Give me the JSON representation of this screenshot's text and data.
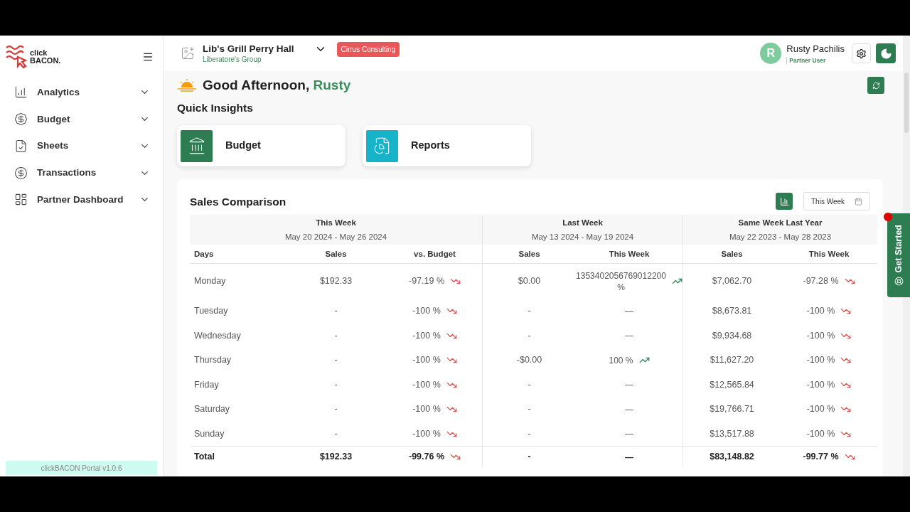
{
  "logo": {
    "line1": "click",
    "line2": "BACON."
  },
  "sidebar": {
    "items": [
      {
        "label": "Analytics"
      },
      {
        "label": "Budget"
      },
      {
        "label": "Sheets"
      },
      {
        "label": "Transactions"
      },
      {
        "label": "Partner Dashboard"
      }
    ],
    "version": "clickBACON Portal v1.0.6"
  },
  "header": {
    "location": "Lib's Grill Perry Hall",
    "group": "Liberatore's Group",
    "badge": "Cirrus Consulting",
    "user": {
      "initial": "R",
      "name": "Rusty Pachilis",
      "role": "Partner User"
    }
  },
  "greeting": {
    "text": "Good Afternoon,",
    "name": "Rusty"
  },
  "quick_insights": {
    "title": "Quick Insights",
    "cards": [
      {
        "label": "Budget",
        "color": "#2e7d52"
      },
      {
        "label": "Reports",
        "color": "#17b3c9"
      }
    ]
  },
  "sales_comparison": {
    "title": "Sales Comparison",
    "period": "This Week",
    "groups": [
      {
        "title": "This Week",
        "range": "May 20 2024 - May 26 2024"
      },
      {
        "title": "Last Week",
        "range": "May 13 2024 - May 19 2024"
      },
      {
        "title": "Same Week Last Year",
        "range": "May 22 2023 - May 28 2023"
      }
    ],
    "columns": [
      "Days",
      "Sales",
      "vs. Budget",
      "Sales",
      "This Week",
      "Sales",
      "This Week"
    ],
    "rows": [
      {
        "kind": "day",
        "cells": [
          {
            "kind": "plain",
            "text": "Monday"
          },
          {
            "kind": "plain",
            "text": "$192.33"
          },
          {
            "kind": "down",
            "text": "-97.19 %"
          },
          {
            "kind": "plain",
            "text": "$0.00"
          },
          {
            "kind": "up",
            "text": "1353402056769012200 %"
          },
          {
            "kind": "plain",
            "text": "$7,062.70"
          },
          {
            "kind": "down",
            "text": "-97.28 %"
          }
        ]
      },
      {
        "kind": "day",
        "cells": [
          {
            "kind": "plain",
            "text": "Tuesday"
          },
          {
            "kind": "plain",
            "text": "-"
          },
          {
            "kind": "down",
            "text": "-100 %"
          },
          {
            "kind": "plain",
            "text": "-"
          },
          {
            "kind": "plain",
            "text": "—"
          },
          {
            "kind": "plain",
            "text": "$8,673.81"
          },
          {
            "kind": "down",
            "text": "-100 %"
          }
        ]
      },
      {
        "kind": "day",
        "cells": [
          {
            "kind": "plain",
            "text": "Wednesday"
          },
          {
            "kind": "plain",
            "text": "-"
          },
          {
            "kind": "down",
            "text": "-100 %"
          },
          {
            "kind": "plain",
            "text": "-"
          },
          {
            "kind": "plain",
            "text": "—"
          },
          {
            "kind": "plain",
            "text": "$9,934.68"
          },
          {
            "kind": "down",
            "text": "-100 %"
          }
        ]
      },
      {
        "kind": "day",
        "cells": [
          {
            "kind": "plain",
            "text": "Thursday"
          },
          {
            "kind": "plain",
            "text": "-"
          },
          {
            "kind": "down",
            "text": "-100 %"
          },
          {
            "kind": "plain",
            "text": "-$0.00"
          },
          {
            "kind": "up",
            "text": "100 %"
          },
          {
            "kind": "plain",
            "text": "$11,627.20"
          },
          {
            "kind": "down",
            "text": "-100 %"
          }
        ]
      },
      {
        "kind": "day",
        "cells": [
          {
            "kind": "plain",
            "text": "Friday"
          },
          {
            "kind": "plain",
            "text": "-"
          },
          {
            "kind": "down",
            "text": "-100 %"
          },
          {
            "kind": "plain",
            "text": "-"
          },
          {
            "kind": "plain",
            "text": "—"
          },
          {
            "kind": "plain",
            "text": "$12,565.84"
          },
          {
            "kind": "down",
            "text": "-100 %"
          }
        ]
      },
      {
        "kind": "day",
        "cells": [
          {
            "kind": "plain",
            "text": "Saturday"
          },
          {
            "kind": "plain",
            "text": "-"
          },
          {
            "kind": "down",
            "text": "-100 %"
          },
          {
            "kind": "plain",
            "text": "-"
          },
          {
            "kind": "plain",
            "text": "—"
          },
          {
            "kind": "plain",
            "text": "$19,766.71"
          },
          {
            "kind": "down",
            "text": "-100 %"
          }
        ]
      },
      {
        "kind": "day",
        "cells": [
          {
            "kind": "plain",
            "text": "Sunday"
          },
          {
            "kind": "plain",
            "text": "-"
          },
          {
            "kind": "down",
            "text": "-100 %"
          },
          {
            "kind": "plain",
            "text": "-"
          },
          {
            "kind": "plain",
            "text": "—"
          },
          {
            "kind": "plain",
            "text": "$13,517.88"
          },
          {
            "kind": "down",
            "text": "-100 %"
          }
        ]
      },
      {
        "kind": "total",
        "cells": [
          {
            "kind": "plain",
            "text": "Total"
          },
          {
            "kind": "plain",
            "text": "$192.33"
          },
          {
            "kind": "down",
            "text": "-99.76 %"
          },
          {
            "kind": "plain",
            "text": "-"
          },
          {
            "kind": "plain",
            "text": "—"
          },
          {
            "kind": "plain",
            "text": "$83,148.82"
          },
          {
            "kind": "down",
            "text": "-99.77 %"
          }
        ]
      }
    ]
  },
  "get_started": {
    "label": "Get Started",
    "notification": true
  }
}
